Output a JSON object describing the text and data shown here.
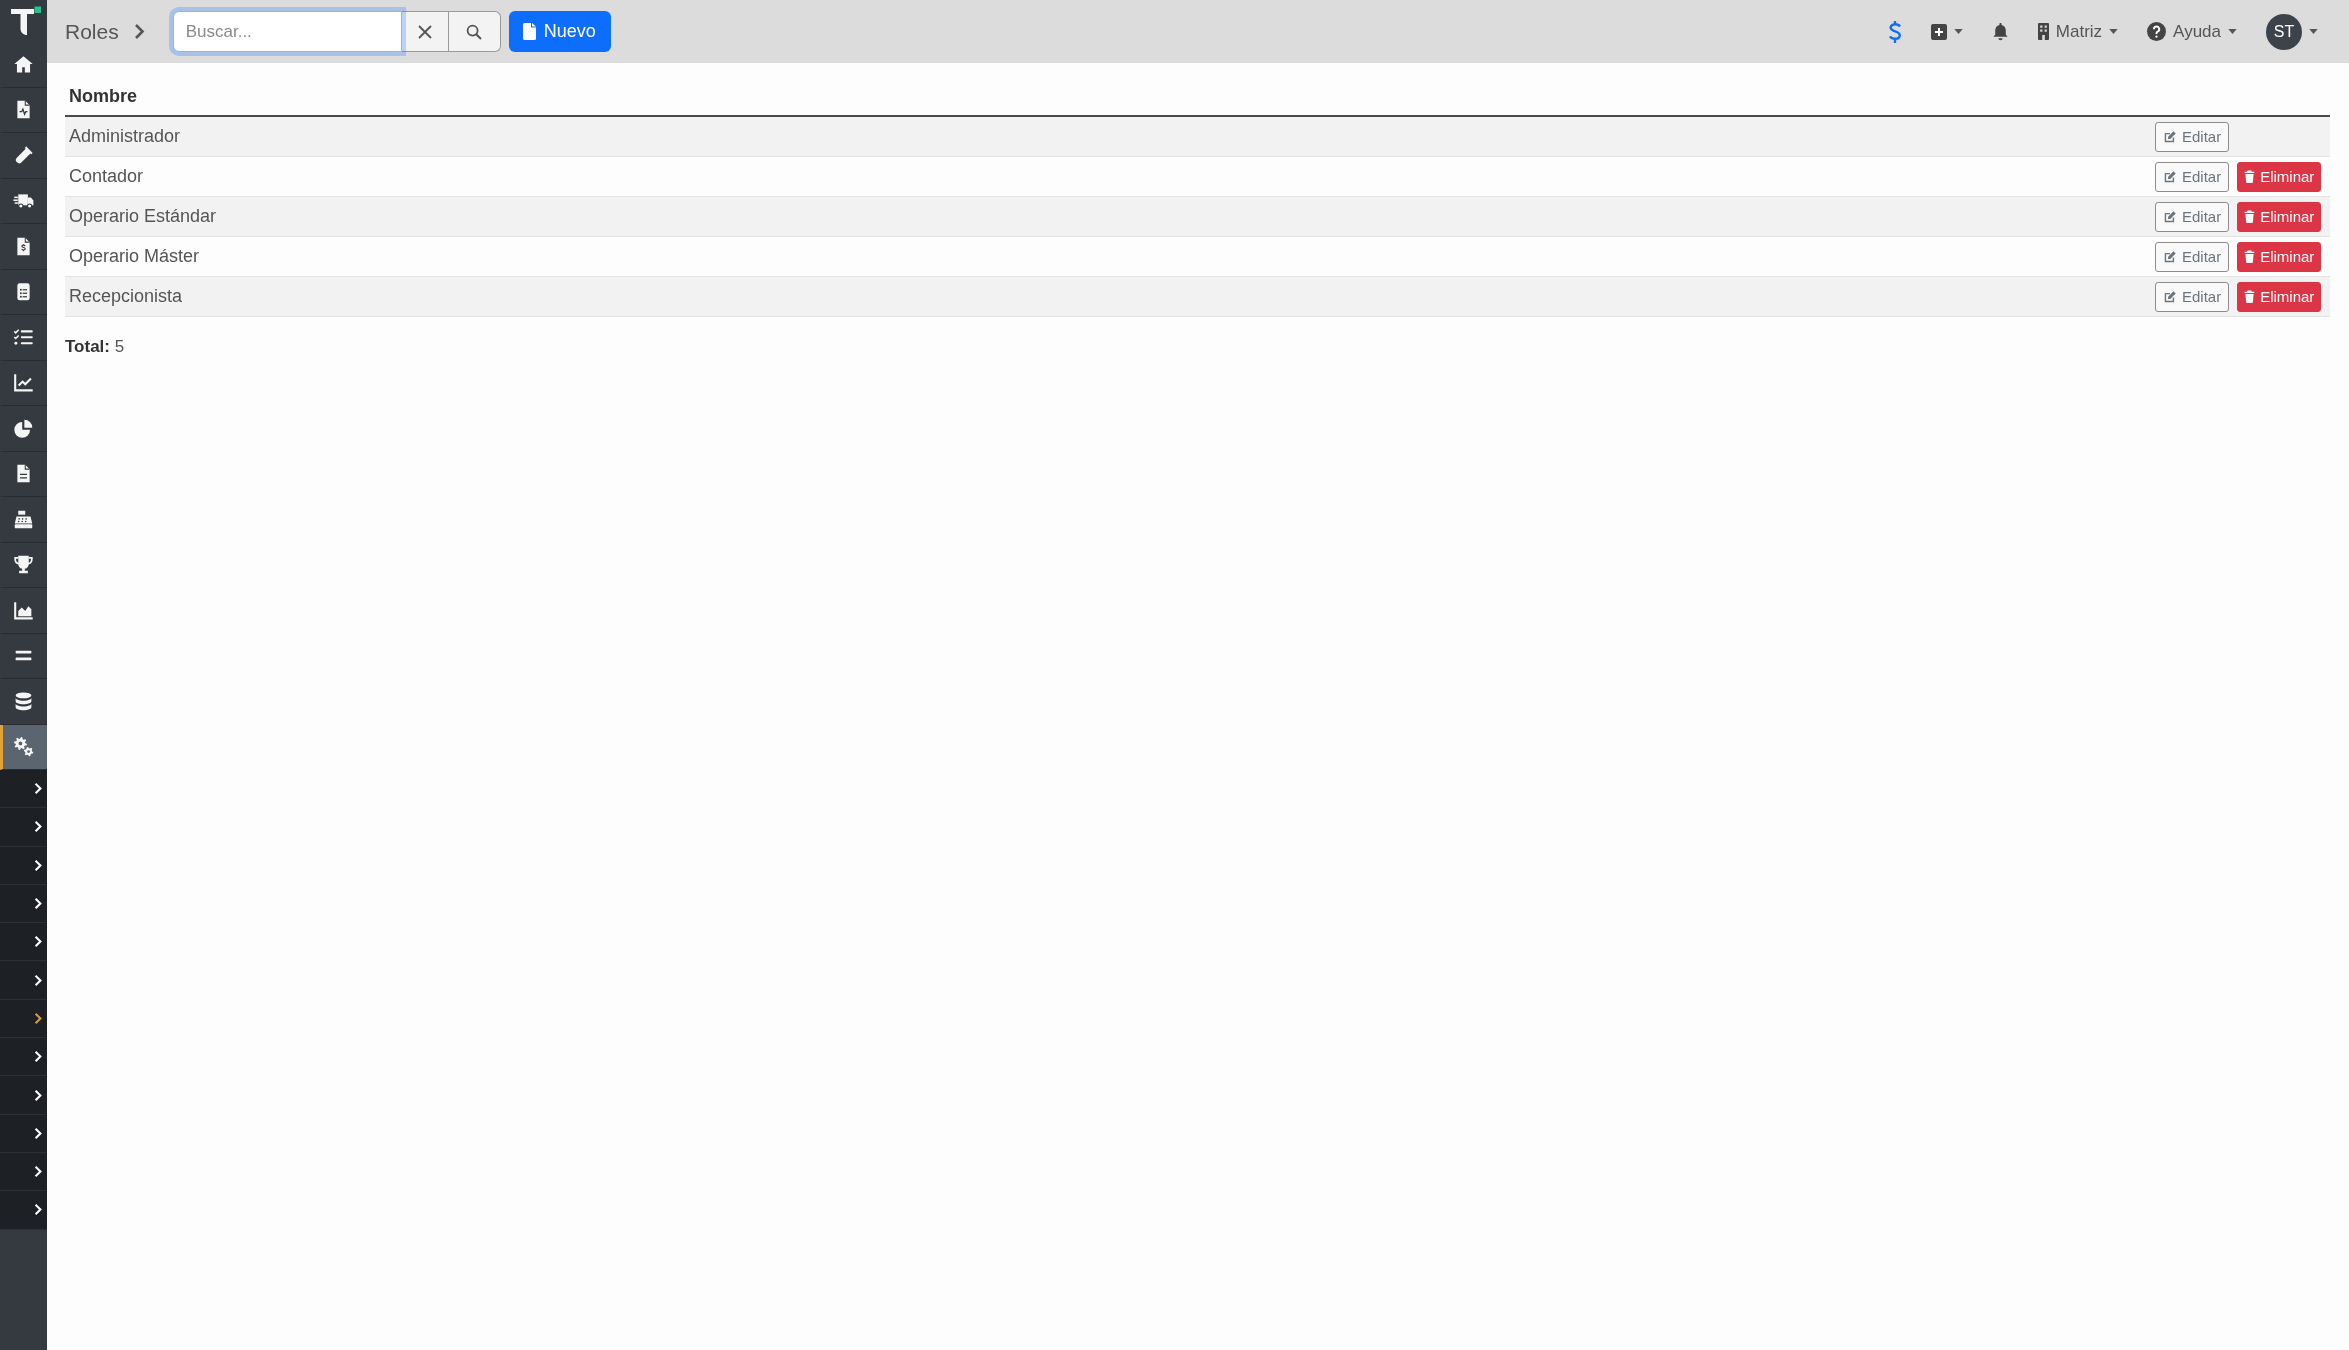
{
  "sidebar": {
    "items": [
      {
        "selected": false
      },
      {
        "selected": false
      },
      {
        "selected": false
      },
      {
        "selected": false
      },
      {
        "selected": false
      },
      {
        "selected": false
      },
      {
        "selected": false
      },
      {
        "selected": false
      },
      {
        "selected": false
      },
      {
        "selected": false
      },
      {
        "selected": false
      },
      {
        "selected": false
      },
      {
        "selected": false
      },
      {
        "selected": false
      },
      {
        "selected": false
      },
      {
        "selected": true
      }
    ],
    "groups": [
      {
        "selected": false
      },
      {
        "selected": false
      },
      {
        "selected": false
      },
      {
        "selected": false
      },
      {
        "selected": false
      },
      {
        "selected": false
      },
      {
        "selected": true
      },
      {
        "selected": false
      },
      {
        "selected": false
      },
      {
        "selected": false
      },
      {
        "selected": false
      },
      {
        "selected": false
      }
    ]
  },
  "topbar": {
    "title": "Roles",
    "search": {
      "placeholder": "Buscar...",
      "focused": true
    },
    "new_button": "Nuevo",
    "branch_menu": "Matriz",
    "help_menu": "Ayuda",
    "avatar": "ST"
  },
  "table": {
    "columns": [
      "Nombre"
    ],
    "rows": [
      {
        "cells": [
          "Administrador"
        ],
        "actions": [
          {
            "kind": "edit",
            "label": "Editar"
          }
        ]
      },
      {
        "cells": [
          "Contador"
        ],
        "actions": [
          {
            "kind": "edit",
            "label": "Editar"
          },
          {
            "kind": "delete",
            "label": "Eliminar"
          }
        ]
      },
      {
        "cells": [
          "Operario Estándar"
        ],
        "actions": [
          {
            "kind": "edit",
            "label": "Editar"
          },
          {
            "kind": "delete",
            "label": "Eliminar"
          }
        ]
      },
      {
        "cells": [
          "Operario Máster"
        ],
        "actions": [
          {
            "kind": "edit",
            "label": "Editar"
          },
          {
            "kind": "delete",
            "label": "Eliminar"
          }
        ]
      },
      {
        "cells": [
          "Recepcionista"
        ],
        "actions": [
          {
            "kind": "edit",
            "label": "Editar"
          },
          {
            "kind": "delete",
            "label": "Eliminar"
          }
        ]
      }
    ]
  },
  "total": "**Total:** 5"
}
